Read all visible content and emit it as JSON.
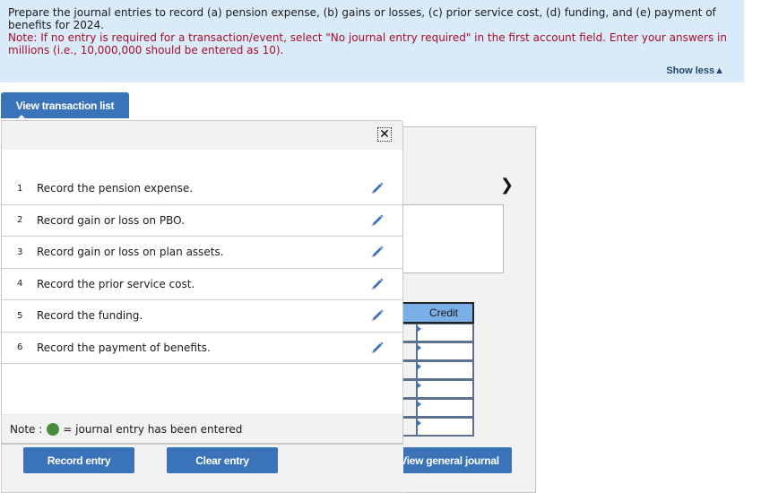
{
  "instructions": {
    "text": "Prepare the journal entries to record (a) pension expense, (b) gains or losses, (c) prior service cost, (d) funding, and (e) payment of benefits for 2024.",
    "note": "Note: If no entry is required for a transaction/event, select \"No journal entry required\" in the first account field. Enter your answers in millions (i.e., 10,000,000 should be entered as 10).",
    "show_less_label": "Show less",
    "show_less_icon": "triangle-up-icon"
  },
  "transaction_panel": {
    "toggle_label": "View transaction list",
    "close_icon": "close-icon",
    "items": [
      {
        "num": "1",
        "label": "Record the pension expense.",
        "icon": "pencil-icon"
      },
      {
        "num": "2",
        "label": "Record gain or loss on PBO.",
        "icon": "pencil-icon"
      },
      {
        "num": "3",
        "label": "Record gain or loss on plan assets.",
        "icon": "pencil-icon"
      },
      {
        "num": "4",
        "label": "Record the prior service cost.",
        "icon": "pencil-icon"
      },
      {
        "num": "5",
        "label": "Record the funding.",
        "icon": "pencil-icon"
      },
      {
        "num": "6",
        "label": "Record the payment of benefits.",
        "icon": "pencil-icon"
      }
    ],
    "note_prefix": "Note :",
    "note_suffix": "= journal entry has been entered",
    "note_dot_color": "#4a8b3f"
  },
  "journal": {
    "next_icon": "chevron-right-icon",
    "credit_header": "Credit",
    "credit_rows": [
      "",
      "",
      "",
      "",
      "",
      ""
    ]
  },
  "buttons": {
    "record_entry": "Record entry",
    "clear_entry": "Clear entry",
    "view_general_journal": "View general journal"
  },
  "colors": {
    "accent": "#3a73b8",
    "instruction_bg": "#d9ebf9",
    "note_text": "#a50e2a",
    "header_blue": "#7aaee6"
  }
}
